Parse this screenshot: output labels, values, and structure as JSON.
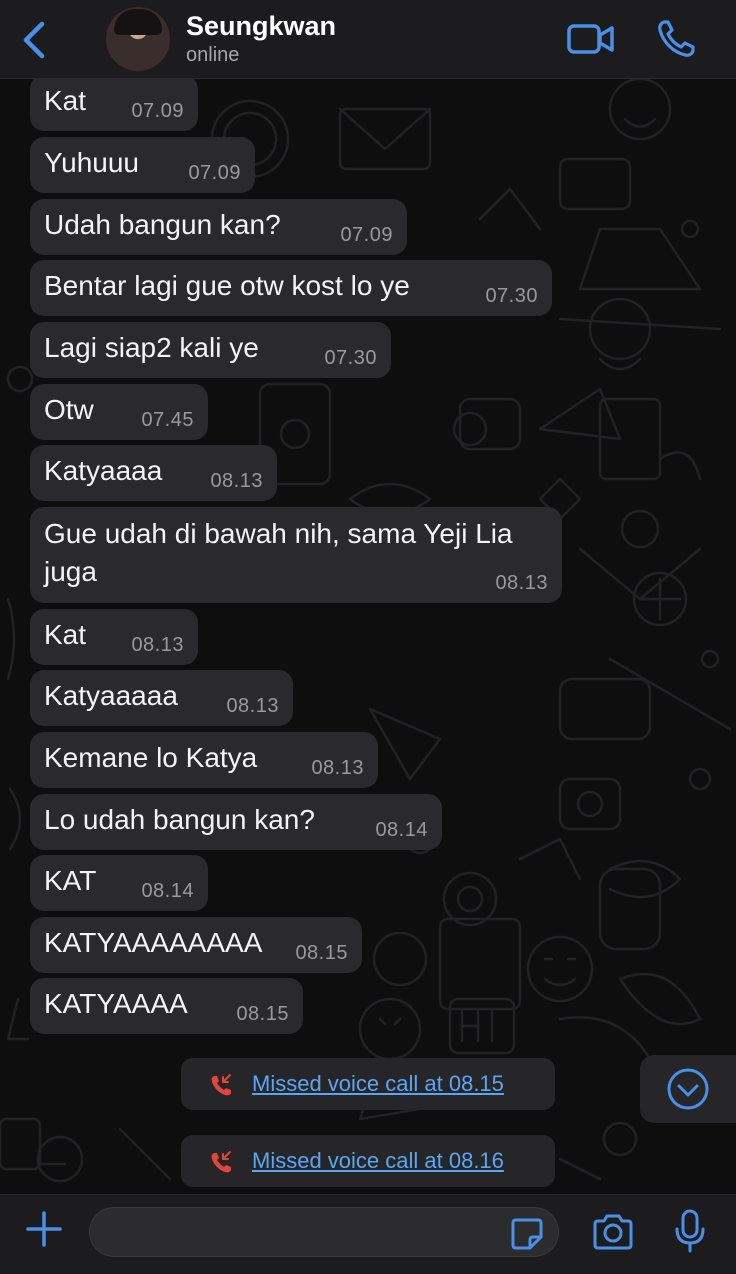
{
  "header": {
    "contact_name": "Seungkwan",
    "status": "online"
  },
  "messages": [
    {
      "text": "Kat",
      "time": "07.09"
    },
    {
      "text": "Yuhuuu",
      "time": "07.09"
    },
    {
      "text": "Udah bangun kan?",
      "time": "07.09"
    },
    {
      "text": "Bentar lagi gue otw kost lo ye",
      "time": "07.30"
    },
    {
      "text": "Lagi siap2 kali ye",
      "time": "07.30"
    },
    {
      "text": "Otw",
      "time": "07.45"
    },
    {
      "text": "Katyaaaa",
      "time": "08.13"
    },
    {
      "text": "Gue udah di bawah nih, sama Yeji Lia juga",
      "time": "08.13"
    },
    {
      "text": "Kat",
      "time": "08.13"
    },
    {
      "text": "Katyaaaaa",
      "time": "08.13"
    },
    {
      "text": "Kemane lo Katya",
      "time": "08.13"
    },
    {
      "text": "Lo udah bangun kan?",
      "time": "08.14"
    },
    {
      "text": "KAT",
      "time": "08.14"
    },
    {
      "text": "KATYAAAAAAAA",
      "time": "08.15"
    },
    {
      "text": "KATYAAAA",
      "time": "08.15"
    }
  ],
  "calls": [
    {
      "text": "Missed voice call at 08.15",
      "icon": "missed-call-icon"
    },
    {
      "text": "Missed voice call at 08.16",
      "icon": "missed-call-icon"
    }
  ],
  "composer": {
    "value": "",
    "placeholder": ""
  },
  "colors": {
    "accent": "#4a8fe8",
    "missed": "#e2453c",
    "bubble": "#2a2a2c",
    "link": "#5aa6f5"
  }
}
